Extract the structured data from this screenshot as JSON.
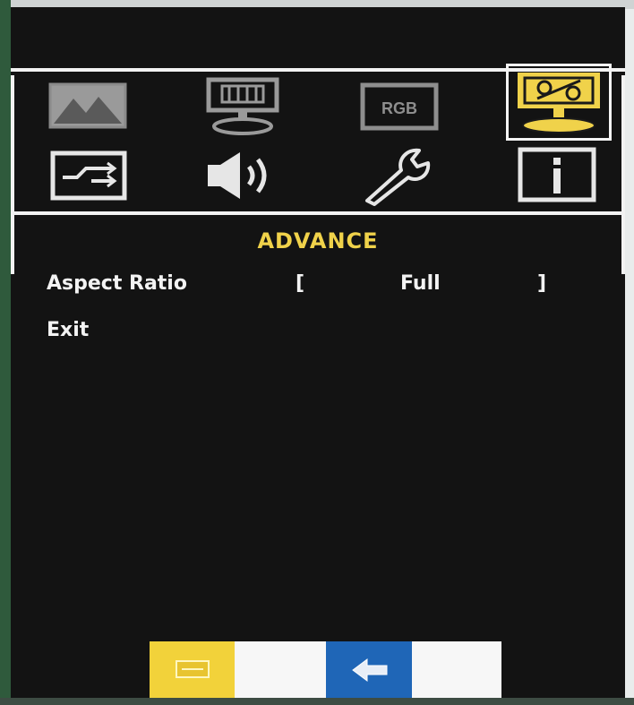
{
  "menu": {
    "title": "ADVANCE",
    "rows": [
      {
        "label": "Aspect Ratio",
        "bracket_open": "[",
        "value": "Full",
        "bracket_close": "]"
      },
      {
        "label": "Exit"
      }
    ]
  },
  "icons": {
    "row1": [
      "picture-icon",
      "display-icon",
      "rgb-input-icon",
      "advance-icon"
    ],
    "row2": [
      "input-switch-icon",
      "speaker-icon",
      "wrench-icon",
      "info-icon"
    ],
    "rgb_text": "RGB",
    "selected": "advance-icon"
  },
  "colors": {
    "background": "#131313",
    "accent_yellow": "#f0d24a",
    "text": "#f3f3f3",
    "button_blue": "#1f66b7"
  },
  "buttons": {
    "menu_key": "menu-key-icon",
    "back_key": "back-arrow-icon"
  }
}
